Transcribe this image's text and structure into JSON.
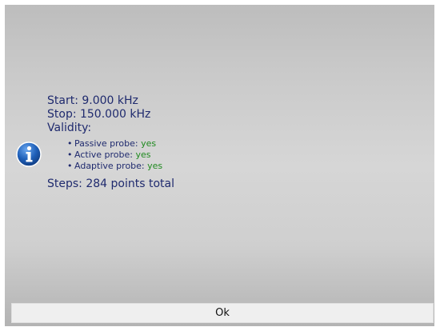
{
  "dialog": {
    "icon": "info-icon",
    "start_line": "Start: 9.000 kHz",
    "stop_line": "Stop: 150.000 kHz",
    "validity_label": "Validity:",
    "probes": [
      {
        "label": "Passive probe:",
        "value": "yes"
      },
      {
        "label": "Active probe:",
        "value": "yes"
      },
      {
        "label": "Adaptive probe:",
        "value": "yes"
      }
    ],
    "steps_line": "Steps: 284 points total",
    "ok_label": "Ok"
  },
  "colors": {
    "text": "#1f2a6e",
    "value_yes": "#1f8a1f",
    "icon_blue": "#1e5fb8",
    "button_bg": "#efefef"
  }
}
